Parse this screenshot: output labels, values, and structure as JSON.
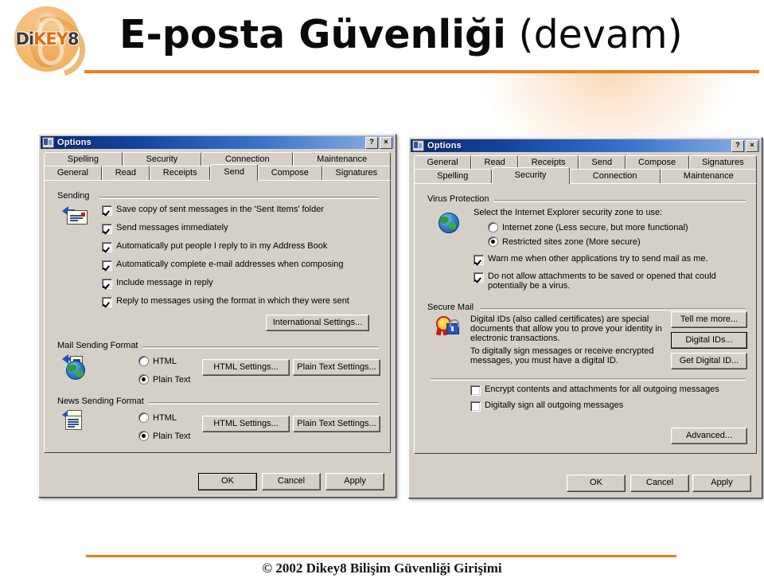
{
  "slide": {
    "title_strong": "E-posta Güvenliği",
    "title_light": " (devam)",
    "logo_text_a": "Di",
    "logo_text_b": "KEY",
    "logo_text_c": "8",
    "footer": "© 2002 Dikey8 Bilişim Güvenliği Girişimi",
    "accent_color": "#ef7d1a",
    "logo_color": "#eda95a"
  },
  "dialog_send": {
    "title": "Options",
    "help_button": "?",
    "close_button": "×",
    "tabs_back": [
      "Spelling",
      "Security",
      "Connection",
      "Maintenance"
    ],
    "tabs_front": [
      "General",
      "Read",
      "Receipts",
      "Send",
      "Compose",
      "Signatures"
    ],
    "active_tab": "Send",
    "group_sending": "Sending",
    "checkboxes": [
      {
        "label": "Save copy of sent messages in the 'Sent Items' folder",
        "checked": true
      },
      {
        "label": "Send messages immediately",
        "checked": true
      },
      {
        "label": "Automatically put people I reply to in my Address Book",
        "checked": true
      },
      {
        "label": "Automatically complete e-mail addresses when composing",
        "checked": true
      },
      {
        "label": "Include message in reply",
        "checked": true
      },
      {
        "label": "Reply to messages using the format in which they were sent",
        "checked": true
      }
    ],
    "international_button": "International Settings...",
    "group_mail_format": "Mail Sending Format",
    "mail_radio_html": "HTML",
    "mail_radio_plain": "Plain Text",
    "mail_selected": "Plain Text",
    "mail_html_settings": "HTML Settings...",
    "mail_plain_settings": "Plain Text Settings...",
    "group_news_format": "News Sending Format",
    "news_radio_html": "HTML",
    "news_radio_plain": "Plain Text",
    "news_selected": "Plain Text",
    "news_html_settings": "HTML Settings...",
    "news_plain_settings": "Plain Text Settings...",
    "ok": "OK",
    "cancel": "Cancel",
    "apply": "Apply"
  },
  "dialog_security": {
    "title": "Options",
    "help_button": "?",
    "close_button": "×",
    "tabs_back": [
      "General",
      "Read",
      "Receipts",
      "Send",
      "Compose",
      "Signatures"
    ],
    "tabs_front": [
      "Spelling",
      "Security",
      "Connection",
      "Maintenance"
    ],
    "active_tab": "Security",
    "group_virus": "Virus Protection",
    "zone_prompt": "Select the Internet Explorer security zone to use:",
    "zone_internet": "Internet zone (Less secure, but more functional)",
    "zone_restricted": "Restricted sites zone (More secure)",
    "zone_selected": "Restricted sites zone (More secure)",
    "checkboxes": [
      {
        "label": "Warn me when other applications try to send mail as me.",
        "checked": true
      },
      {
        "label": "Do not allow attachments to be saved or opened that could potentially be a virus.",
        "checked": true
      }
    ],
    "group_secure_mail": "Secure Mail",
    "secure_para1": "Digital IDs (also called certificates) are special documents that allow you to prove your identity in electronic transactions.",
    "secure_para2": "To digitally sign messages or receive encrypted messages, you must have a digital ID.",
    "tell_me_more": "Tell me more...",
    "digital_ids": "Digital IDs...",
    "get_digital_id": "Get Digital ID...",
    "encrypt_checkbox": "Encrypt contents and attachments for all outgoing messages",
    "encrypt_checked": false,
    "sign_checkbox": "Digitally sign all outgoing messages",
    "sign_checked": false,
    "advanced": "Advanced...",
    "ok": "OK",
    "cancel": "Cancel",
    "apply": "Apply"
  }
}
